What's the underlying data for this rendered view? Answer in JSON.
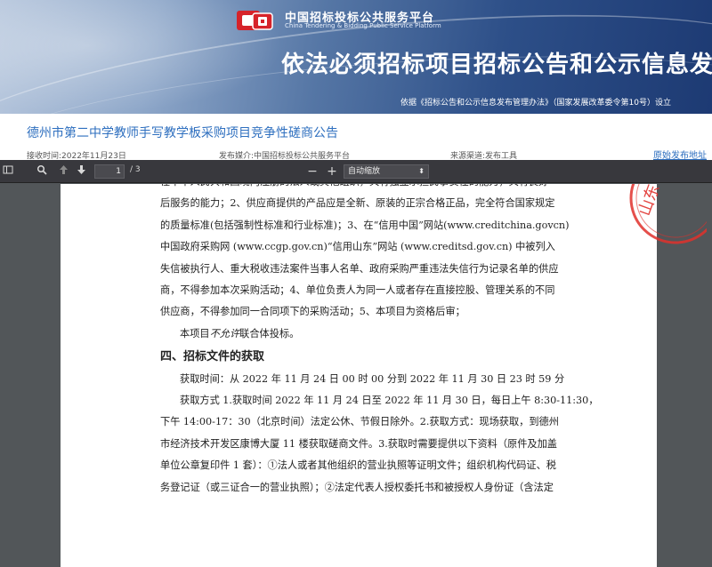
{
  "banner": {
    "logo_title": "中国招标投标公共服务平台",
    "logo_subtitle": "China Tendering & Bidding Public Service Platform",
    "title": "依法必须招标项目招标公告和公示信息发布",
    "note": "依据《招标公告和公示信息发布管理办法》（国家发展改革委令第10号）设立",
    "brand_color": "#d6232a"
  },
  "notice": {
    "title": "德州市第二中学教师手写教学板采购项目竞争性磋商公告",
    "received_time": "接收时间:2022年11月23日",
    "publish_media": "发布媒介:中国招标投标公共服务平台",
    "source": "来源渠道:发布工具",
    "original_link": "原始发布地址"
  },
  "toolbar": {
    "page_number": "1",
    "page_count": "/ 3",
    "zoom": "自动缩放"
  },
  "doc": {
    "lines_top": [
      "在中华人民共和国境内注册的法人或其他组织，具有独立承担民事责任的能力，具有良好",
      "后服务的能力；2、供应商提供的产品应是全新、原装的正宗合格正品，完全符合国家规定",
      "的质量标准(包括强制性标准和行业标准)；3、在“信用中国”网站(www.creditchina.govcn)",
      "中国政府采购网 (www.ccgp.gov.cn)“信用山东”网站 (www.creditsd.gov.cn) 中被列入",
      "失信被执行人、重大税收违法案件当事人名单、政府采购严重违法失信行为记录名单的供应",
      "商，不得参加本次采购活动；4、单位负责人为同一人或者存在直接控股、管理关系的不同",
      "供应商，不得参加同一合同项下的采购活动；5、本项目为资格后审；"
    ],
    "consortium_prefix": "本项目",
    "consortium_em": "不允许",
    "consortium_suffix": "联合体投标。",
    "section_heading": "四、招标文件的获取",
    "lines_bottom": [
      "获取时间：从 2022 年 11 月 24 日 00 时 00 分到 2022 年 11 月 30 日 23 时 59 分",
      "获取方式 1.获取时间 2022 年 11 月 24 日至 2022 年 11 月 30 日，每日上午 8:30-11:30，",
      "下午 14:00-17：30（北京时间）法定公休、节假日除外。2.获取方式：现场获取，到德州",
      "市经济技术开发区康博大厦 11 楼获取磋商文件。3.获取时需要提供以下资料（原件及加盖",
      "单位公章复印件 1 套）：①法人或者其他组织的营业执照等证明文件；组织机构代码证、税",
      "务登记证（或三证合一的营业执照）；②法定代表人授权委托书和被授权人身份证（含法定"
    ],
    "seal_text": "山东",
    "seal_color": "#e0302c"
  }
}
